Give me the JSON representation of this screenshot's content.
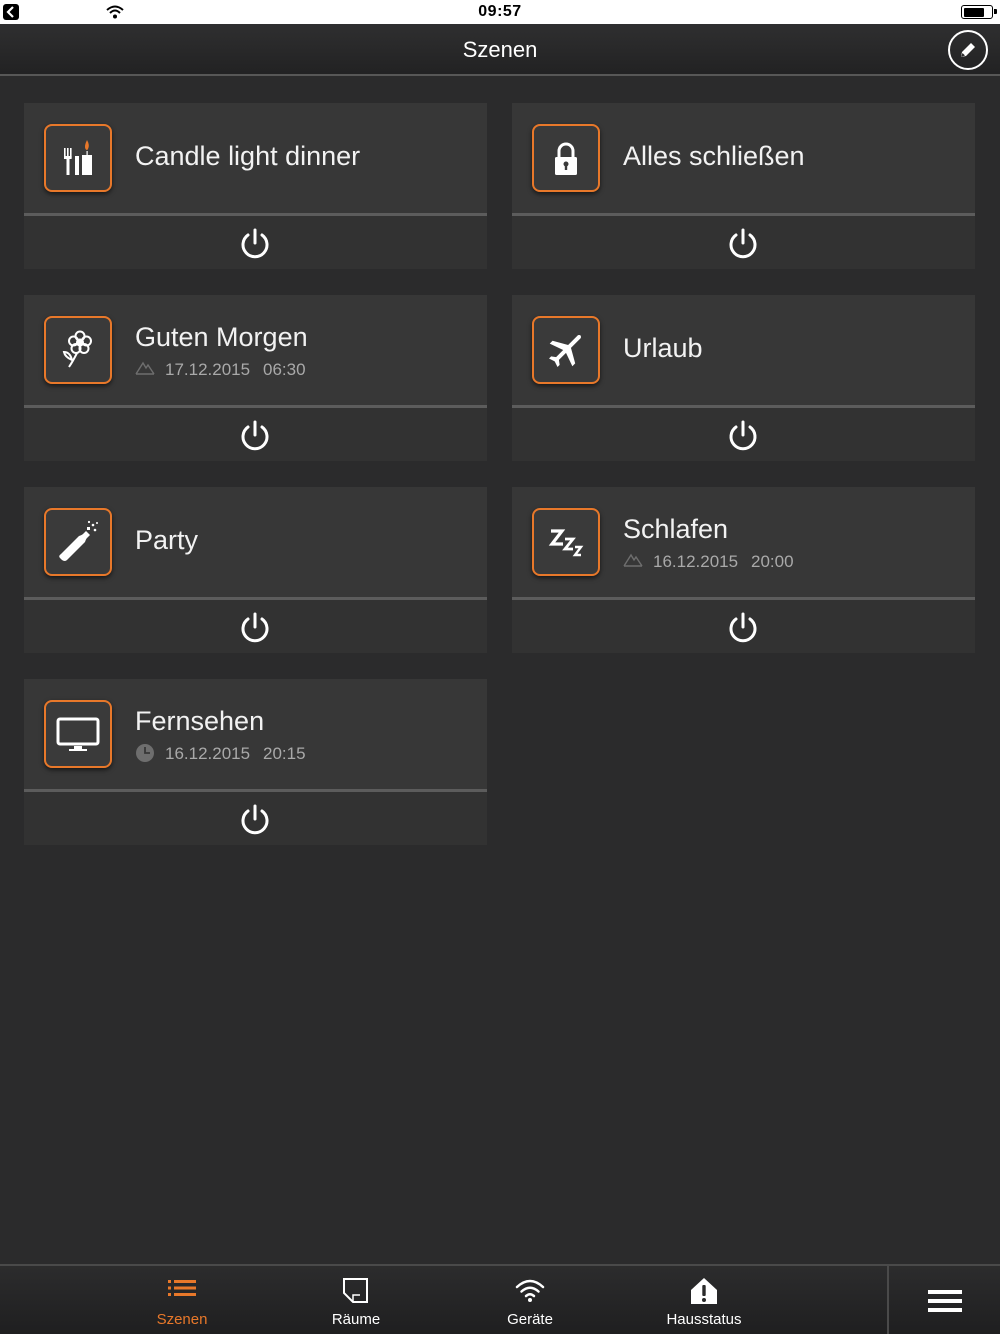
{
  "status_bar": {
    "time": "09:57"
  },
  "header": {
    "title": "Szenen"
  },
  "scenes": [
    {
      "name": "Candle light dinner",
      "icon": "candle-dinner-icon"
    },
    {
      "name": "Alles schließen",
      "icon": "lock-icon"
    },
    {
      "name": "Guten Morgen",
      "icon": "flower-icon",
      "schedule": {
        "type": "sun",
        "date": "17.12.2015",
        "time": "06:30"
      }
    },
    {
      "name": "Urlaub",
      "icon": "airplane-icon"
    },
    {
      "name": "Party",
      "icon": "champagne-bottle-icon"
    },
    {
      "name": "Schlafen",
      "icon": "sleep-zzz-icon",
      "schedule": {
        "type": "sun",
        "date": "16.12.2015",
        "time": "20:00"
      }
    },
    {
      "name": "Fernsehen",
      "icon": "tv-icon",
      "schedule": {
        "type": "clock",
        "date": "16.12.2015",
        "time": "20:15"
      }
    }
  ],
  "tabs": [
    {
      "label": "Szenen",
      "icon": "list-icon",
      "active": true
    },
    {
      "label": "Räume",
      "icon": "room-icon",
      "active": false
    },
    {
      "label": "Geräte",
      "icon": "wifi-signal-icon",
      "active": false
    },
    {
      "label": "Hausstatus",
      "icon": "warning-house-icon",
      "active": false
    }
  ],
  "colors": {
    "accent": "#e8782a",
    "background": "#2b2b2c",
    "card": "#373737"
  }
}
